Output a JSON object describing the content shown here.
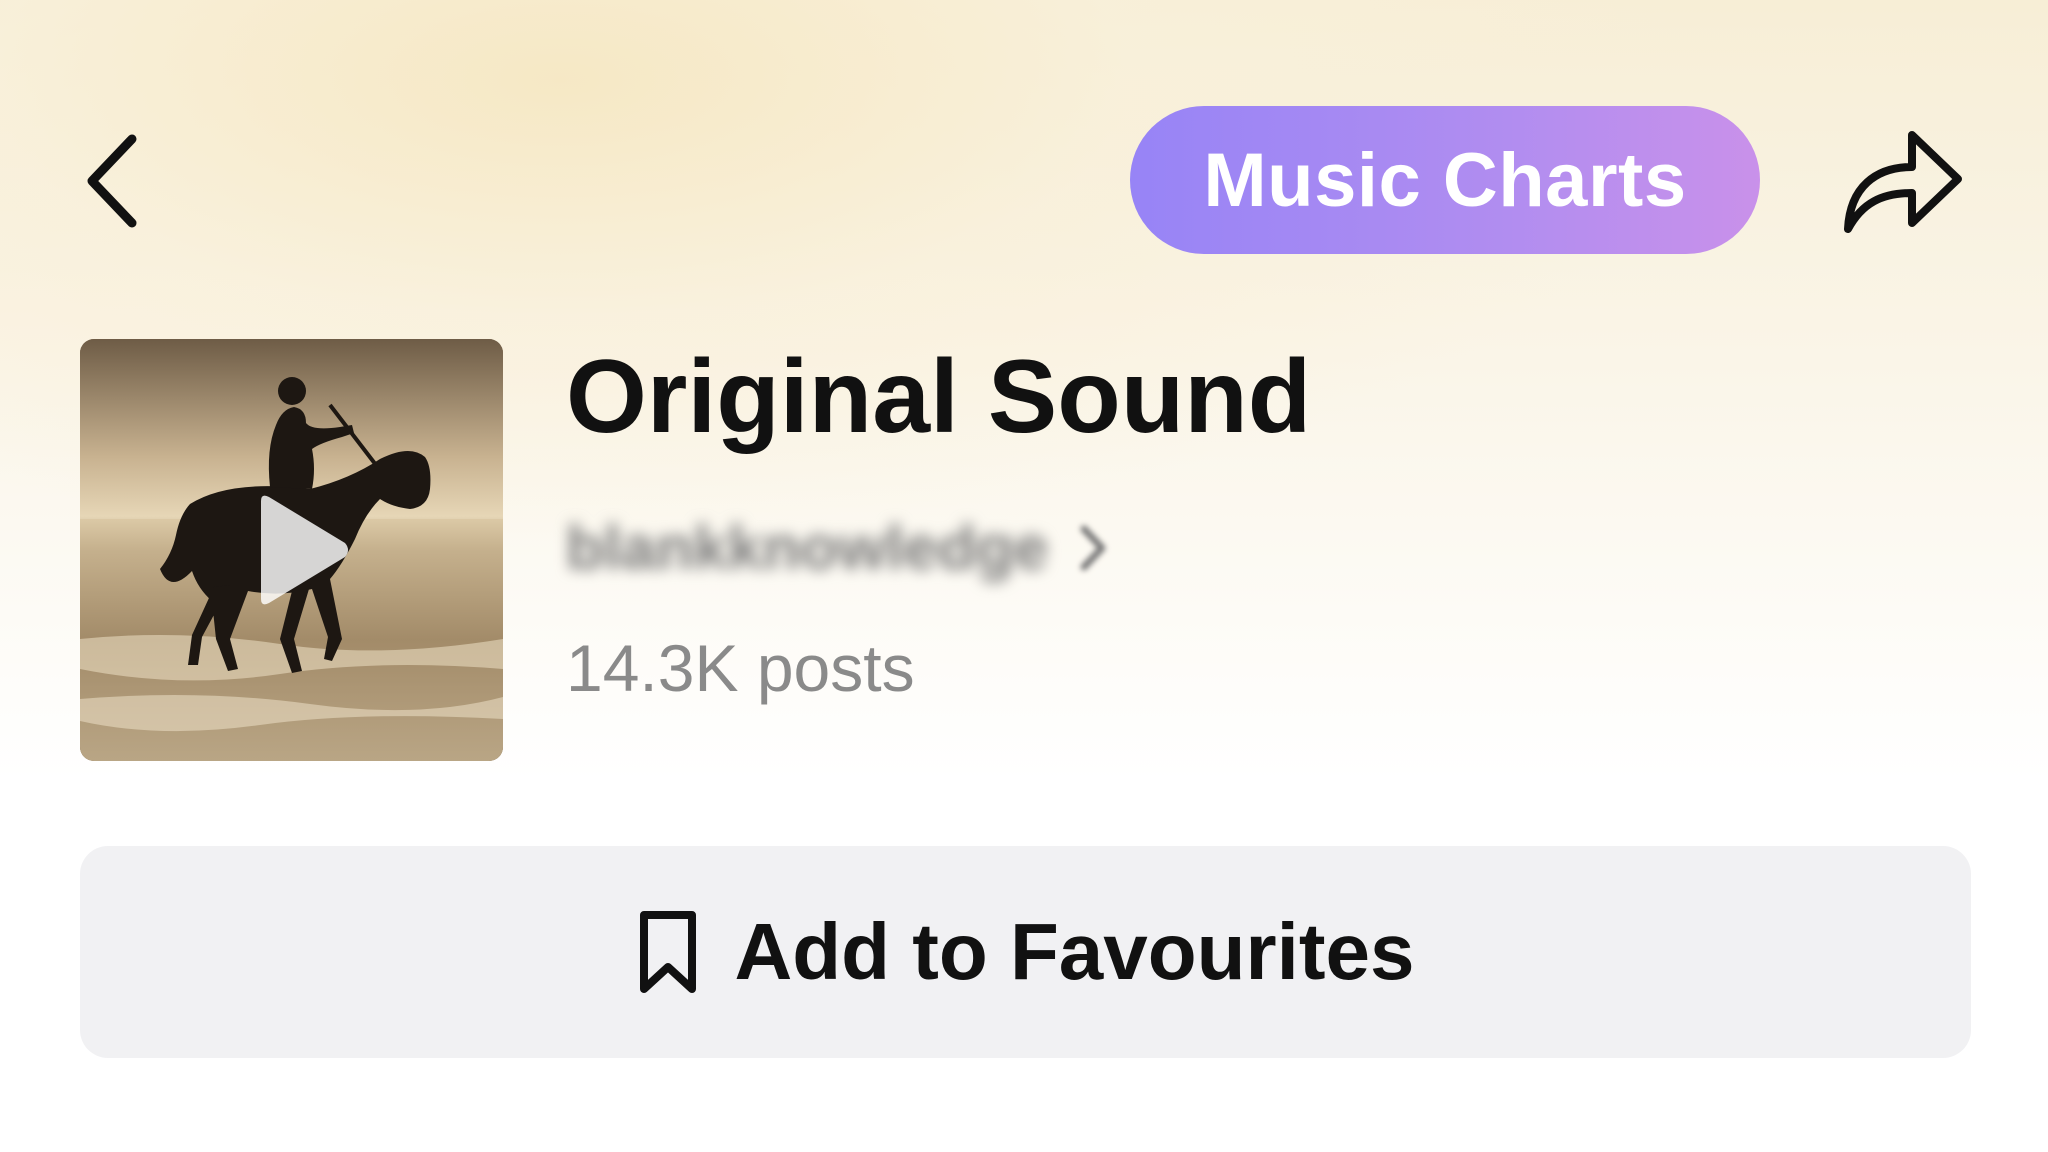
{
  "header": {
    "back_icon": "chevron-left-icon",
    "charts_label": "Music Charts",
    "share_icon": "share-arrow-icon"
  },
  "sound": {
    "title": "Original Sound",
    "author": "blankknowledge",
    "posts": "14.3K posts",
    "cover_icon": "play-icon"
  },
  "actions": {
    "favourite_label": "Add to Favourites",
    "favourite_icon": "bookmark-icon"
  },
  "colors": {
    "pill_start": "#9784f6",
    "pill_end": "#c991ea",
    "button_bg": "#f1f1f3",
    "text_primary": "#111111",
    "text_secondary": "#8a8a8a"
  }
}
